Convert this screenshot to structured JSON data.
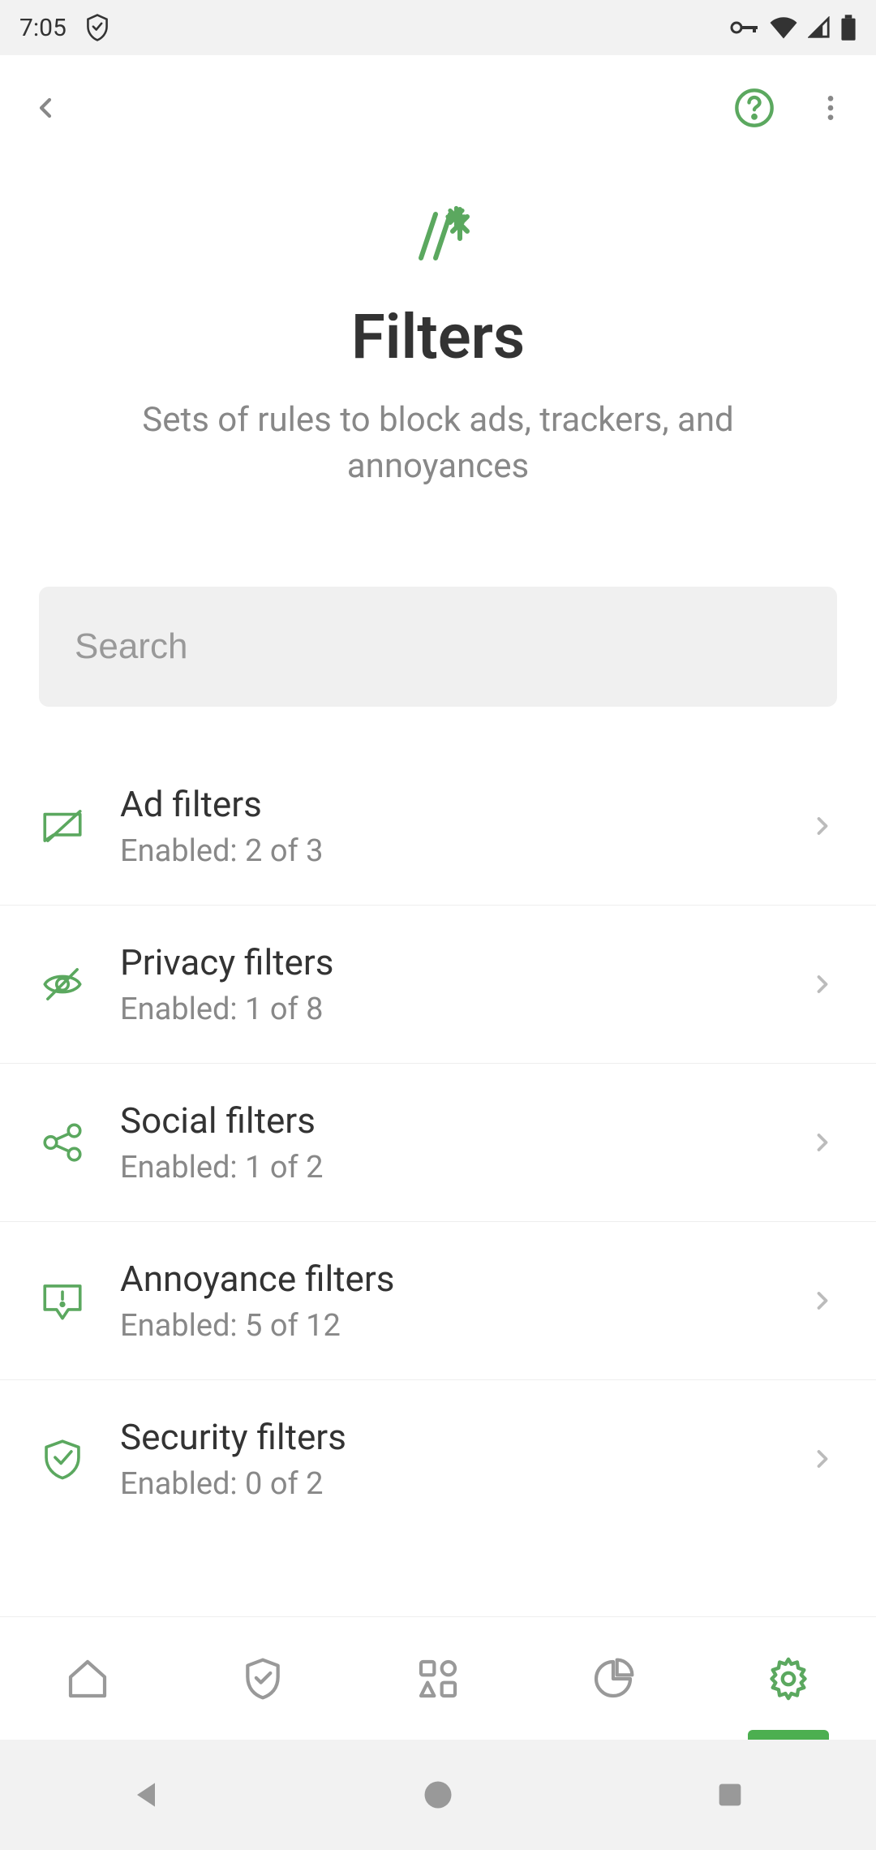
{
  "statusbar": {
    "time": "7:05"
  },
  "header": {
    "title": "Filters",
    "subtitle": "Sets of rules to block ads, trackers, and annoyances"
  },
  "search": {
    "placeholder": "Search"
  },
  "filters": [
    {
      "title": "Ad filters",
      "subtitle": "Enabled: 2 of 3"
    },
    {
      "title": "Privacy filters",
      "subtitle": "Enabled: 1 of 8"
    },
    {
      "title": "Social filters",
      "subtitle": "Enabled: 1 of 2"
    },
    {
      "title": "Annoyance filters",
      "subtitle": "Enabled: 5 of 12"
    },
    {
      "title": "Security filters",
      "subtitle": "Enabled: 0 of 2"
    }
  ],
  "colors": {
    "accent": "#5ba85f",
    "text": "#333",
    "muted": "#888"
  }
}
